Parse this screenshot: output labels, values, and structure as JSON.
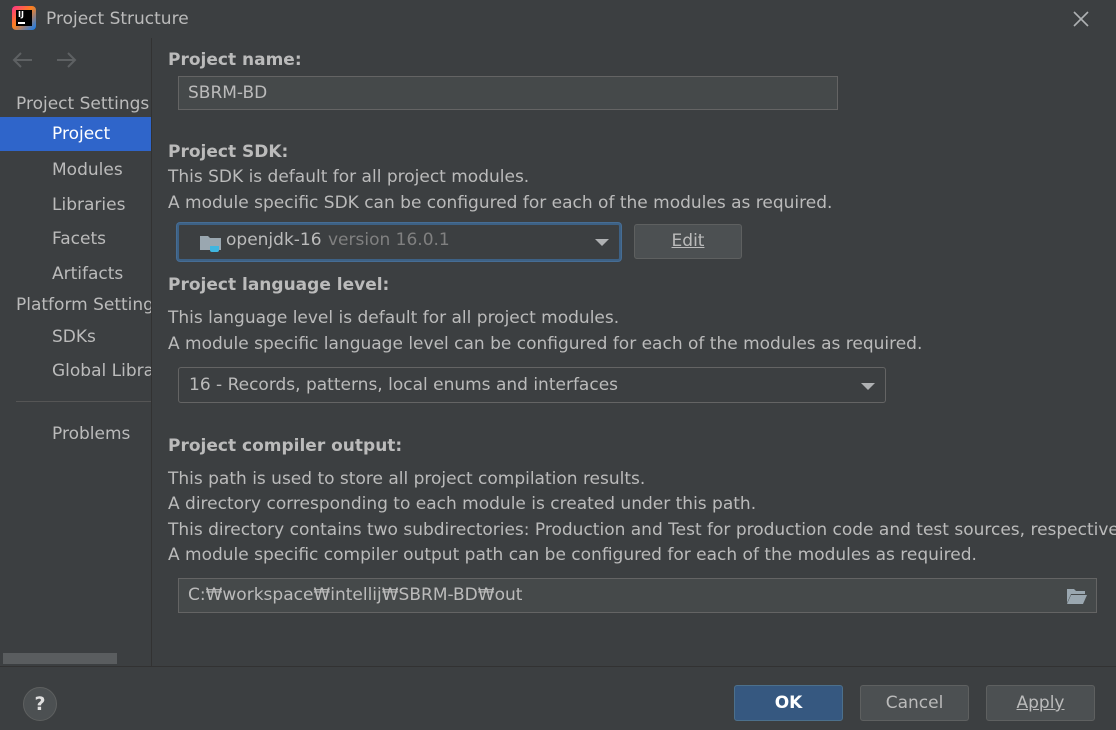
{
  "window": {
    "title": "Project Structure"
  },
  "sidebar": {
    "groups": {
      "project_settings": "Project Settings",
      "platform_settings": "Platform Settings"
    },
    "items": [
      {
        "label": "Project"
      },
      {
        "label": "Modules"
      },
      {
        "label": "Libraries"
      },
      {
        "label": "Facets"
      },
      {
        "label": "Artifacts"
      },
      {
        "label": "SDKs"
      },
      {
        "label": "Global Libraries"
      },
      {
        "label": "Problems"
      }
    ],
    "selected": "Project"
  },
  "project": {
    "name_label": "Project name:",
    "name_value": "SBRM-BD",
    "sdk_label": "Project SDK:",
    "sdk_desc1": "This SDK is default for all project modules.",
    "sdk_desc2": "A module specific SDK can be configured for each of the modules as required.",
    "sdk_name": "openjdk-16",
    "sdk_version": "version 16.0.1",
    "edit_button": "Edit",
    "lang_label": "Project language level:",
    "lang_desc1": "This language level is default for all project modules.",
    "lang_desc2": "A module specific language level can be configured for each of the modules as required.",
    "lang_value": "16 - Records, patterns, local enums and interfaces",
    "output_label": "Project compiler output:",
    "output_desc1": "This path is used to store all project compilation results.",
    "output_desc2": "A directory corresponding to each module is created under this path.",
    "output_desc3": "This directory contains two subdirectories: Production and Test for production code and test sources, respectively.",
    "output_desc4": "A module specific compiler output path can be configured for each of the modules as required.",
    "output_path": "C:₩workspace₩intellij₩SBRM-BD₩out"
  },
  "footer": {
    "help": "?",
    "ok": "OK",
    "cancel": "Cancel",
    "apply": "Apply"
  },
  "icons": [
    "intellij-logo-icon",
    "close-icon",
    "back-arrow-icon",
    "forward-arrow-icon",
    "folder-icon",
    "dropdown-arrow-icon",
    "browse-folder-icon",
    "help-icon"
  ],
  "colors": {
    "background": "#3c3f41",
    "selection": "#2f65ca",
    "primary_button": "#365880",
    "text": "#bbbbbb"
  }
}
